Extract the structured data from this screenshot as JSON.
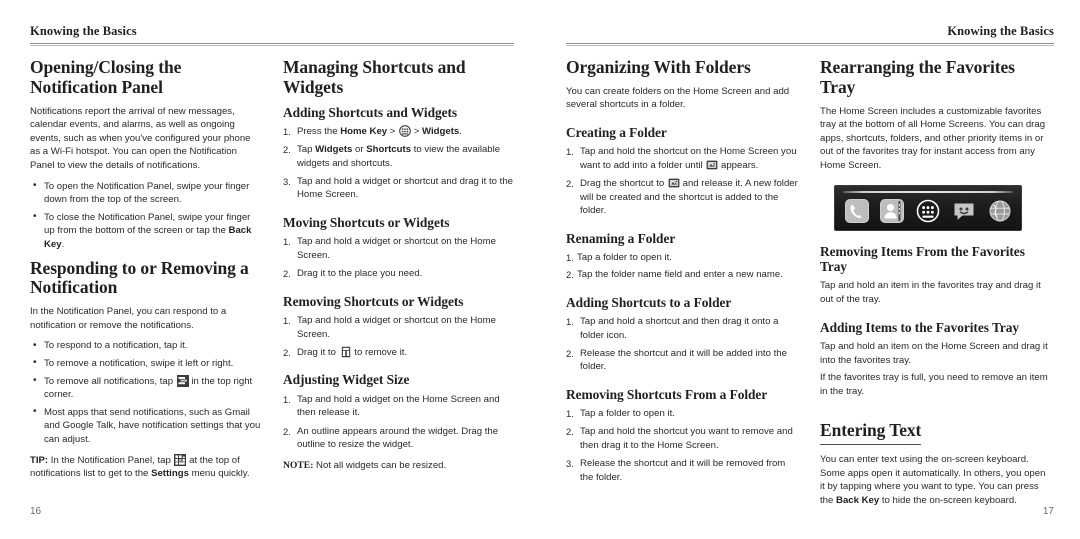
{
  "spread": {
    "left_page": {
      "running_head": "Knowing the Basics",
      "folio": "16",
      "columns": [
        {
          "sections": [
            {
              "heading": "Opening/Closing the Notification Panel",
              "paragraphs": [
                "Notifications report the arrival of new messages, calendar events, and alarms, as well as ongoing events, such as when you've configured your phone as a Wi-Fi hotspot. You can open the Notification Panel to view the details of notifications."
              ],
              "bullets": [
                "To open the Notification Panel, swipe your finger down from the top of the screen.",
                "To close the Notification Panel, swipe your finger up from the bottom of the screen or tap the Back Key."
              ]
            },
            {
              "heading": "Responding to or Removing a Notification",
              "paragraphs": [
                "In the Notification Panel, you can respond to a notification or remove the notifications."
              ],
              "bullets": [
                "To respond to a notification, tap it.",
                "To remove a notification, swipe it left or right.",
                "To remove all notifications, tap [clear-notifications-icon] in the top right corner.",
                "Most apps that send notifications, such as Gmail and Google Talk, have notification settings that you can adjust."
              ],
              "tip": "TIP: In the Notification Panel, tap [settings-icon] at the top of notifications list to get to the Settings menu quickly."
            }
          ]
        },
        {
          "sections": [
            {
              "heading": "Managing Shortcuts and Widgets",
              "subsections": [
                {
                  "heading": "Adding Shortcuts and Widgets",
                  "steps": [
                    "Press the Home Key > [app-drawer-icon] > Widgets.",
                    "Tap Widgets or Shortcuts to view the available widgets and shortcuts.",
                    "Tap and hold a widget or shortcut and drag it to the Home Screen."
                  ]
                },
                {
                  "heading": "Moving Shortcuts or Widgets",
                  "steps": [
                    "Tap and hold a widget or shortcut on the Home Screen.",
                    "Drag it to the place you need."
                  ]
                },
                {
                  "heading": "Removing Shortcuts or Widgets",
                  "steps": [
                    "Tap and hold a widget or shortcut on the Home Screen.",
                    "Drag it to [remove-trash-icon] to remove it."
                  ]
                },
                {
                  "heading": "Adjusting Widget Size",
                  "steps": [
                    "Tap and hold a widget on the Home Screen and then release it.",
                    "An outline appears around the widget. Drag the outline to resize the widget."
                  ],
                  "note": "NOTE: Not all widgets can be resized."
                }
              ]
            }
          ]
        }
      ]
    },
    "right_page": {
      "running_head": "Knowing the Basics",
      "folio": "17",
      "columns": [
        {
          "sections": [
            {
              "heading": "Organizing With Folders",
              "paragraphs": [
                "You can create folders on the Home Screen and add several shortcuts in a folder."
              ],
              "subsections": [
                {
                  "heading": "Creating a Folder",
                  "steps": [
                    "Tap and hold the shortcut on the Home Screen you want to add into a folder until [folder-icon] appears.",
                    "Drag the shortcut to [folder-icon] and release it. A new folder will be created and the shortcut is added to the folder."
                  ]
                },
                {
                  "heading": "Renaming a Folder",
                  "steps": [
                    "Tap a folder to open it.",
                    "Tap the folder name field and enter a new name."
                  ]
                },
                {
                  "heading": "Adding Shortcuts to a Folder",
                  "steps": [
                    "Tap and hold a shortcut and then drag it onto a folder icon.",
                    "Release the shortcut and it will be added into the folder."
                  ]
                },
                {
                  "heading": "Removing Shortcuts From a Folder",
                  "steps": [
                    "Tap a folder to open it.",
                    "Tap and hold the shortcut you want to remove and then drag it to the Home Screen.",
                    "Release the shortcut and it will be removed from the folder."
                  ]
                }
              ]
            }
          ]
        },
        {
          "sections": [
            {
              "heading": "Rearranging the Favorites Tray",
              "paragraphs": [
                "The Home Screen includes a customizable favorites tray at the bottom of all Home Screens. You can drag apps, shortcuts, folders, and other priority items in or out of the favorites tray for instant access from any Home Screen."
              ],
              "figure": {
                "name": "favorites-tray-figure",
                "icons": [
                  "phone-icon",
                  "contacts-icon",
                  "app-drawer-icon",
                  "messaging-icon",
                  "browser-globe-icon"
                ]
              },
              "subsections": [
                {
                  "heading": "Removing Items From the Favorites Tray",
                  "paragraphs": [
                    "Tap and hold an item in the favorites tray and drag it out of the tray."
                  ]
                },
                {
                  "heading": "Adding Items to the Favorites Tray",
                  "paragraphs": [
                    "Tap and hold an item on the Home Screen and drag it into the favorites tray.",
                    "If the favorites tray is full, you need to remove an item in the tray."
                  ]
                }
              ]
            },
            {
              "heading": "Entering Text",
              "underlined": true,
              "paragraphs": [
                "You can enter text using the on-screen keyboard. Some apps open it automatically. In others, you open it by tapping where you want to type. You can press the Back Key to hide the on-screen keyboard."
              ]
            }
          ]
        }
      ]
    }
  },
  "text": {
    "l_c1_s1_head": "Opening/Closing the Notification Panel",
    "l_c1_s1_p1": "Notifications report the arrival of new messages, calendar events, and alarms, as well as ongoing events, such as when you've configured your phone as a Wi-Fi hotspot. You can open the Notification Panel to view the details of notifications.",
    "l_c1_s1_b1": "To open the Notification Panel, swipe your finger down from the top of the screen.",
    "l_c1_s1_b2a": "To close the Notification Panel, swipe your finger up from the bottom of the screen or tap the ",
    "l_c1_s1_b2b": "Back Key",
    "l_c1_s1_b2c": ".",
    "l_c1_s2_head": "Responding to or Removing a Notification",
    "l_c1_s2_p1": "In the Notification Panel, you can respond to a notification or remove the notifications.",
    "l_c1_s2_b1": "To respond to a notification, tap it.",
    "l_c1_s2_b2": "To remove a notification, swipe it left or right.",
    "l_c1_s2_b3a": "To remove all notifications, tap",
    "l_c1_s2_b3b": "in the top right corner.",
    "l_c1_s2_b4": "Most apps that send notifications, such as Gmail and Google Talk, have notification settings that you can adjust.",
    "l_c1_tip_label": "TIP:",
    "l_c1_tip_a": " In the Notification Panel, tap",
    "l_c1_tip_b": "at the top of notifications list to get to the ",
    "l_c1_tip_bold": "Settings",
    "l_c1_tip_c": " menu quickly.",
    "l_c2_head": "Managing Shortcuts and Widgets",
    "l_c2_s1_head": "Adding Shortcuts and Widgets",
    "l_c2_s1_1a": "Press the ",
    "l_c2_s1_1b": "Home Key",
    "l_c2_s1_1c": " > ",
    "l_c2_s1_1d": " > ",
    "l_c2_s1_1e": "Widgets",
    "l_c2_s1_1f": ".",
    "l_c2_s1_2a": "Tap ",
    "l_c2_s1_2b": "Widgets",
    "l_c2_s1_2c": " or ",
    "l_c2_s1_2d": "Shortcuts",
    "l_c2_s1_2e": " to view the available widgets and shortcuts.",
    "l_c2_s1_3": "Tap and hold a widget or shortcut and drag it to the Home Screen.",
    "l_c2_s2_head": "Moving Shortcuts or Widgets",
    "l_c2_s2_1": "Tap and hold a widget or shortcut on the Home Screen.",
    "l_c2_s2_2": "Drag it to the place you need.",
    "l_c2_s3_head": "Removing Shortcuts or Widgets",
    "l_c2_s3_1": "Tap and hold a widget or shortcut on the Home Screen.",
    "l_c2_s3_2a": "Drag it to",
    "l_c2_s3_2b": "to remove it.",
    "l_c2_s4_head": "Adjusting Widget Size",
    "l_c2_s4_1": "Tap and hold a widget on the Home Screen and then release it.",
    "l_c2_s4_2": "An outline appears around the widget. Drag the outline to resize the widget.",
    "l_c2_note_label": "NOTE:",
    "l_c2_note_text": " Not all widgets can be resized.",
    "r_c1_head": "Organizing With Folders",
    "r_c1_p1": "You can create folders on the Home Screen and add several shortcuts in a folder.",
    "r_c1_s1_head": "Creating a Folder",
    "r_c1_s1_1a": "Tap and hold the shortcut on the Home Screen you want to add into a folder until",
    "r_c1_s1_1b": "appears.",
    "r_c1_s1_2a": "Drag the shortcut to",
    "r_c1_s1_2b": "and release it. A new folder will be created and the shortcut is added to the folder.",
    "r_c1_s2_head": "Renaming a Folder",
    "r_c1_s2_1": "Tap a folder to open it.",
    "r_c1_s2_2": "Tap the folder name field and enter a new name.",
    "r_c1_s3_head": "Adding Shortcuts to a Folder",
    "r_c1_s3_1": "Tap and hold a shortcut and then drag it onto a folder icon.",
    "r_c1_s3_2": "Release the shortcut and it will be added into the folder.",
    "r_c1_s4_head": "Removing Shortcuts From a Folder",
    "r_c1_s4_1": "Tap a folder to open it.",
    "r_c1_s4_2": "Tap and hold the shortcut you want to remove and then drag it to the Home Screen.",
    "r_c1_s4_3": "Release the shortcut and it will be removed from the folder.",
    "r_c2_head": "Rearranging the Favorites Tray",
    "r_c2_p1": "The Home Screen includes a customizable favorites tray at the bottom of all Home Screens. You can drag apps, shortcuts, folders, and other priority items in or out of the favorites tray for instant access from any Home Screen.",
    "r_c2_s1_head": "Removing Items From the Favorites Tray",
    "r_c2_s1_p1": "Tap and hold an item in the favorites tray and drag it out of the tray.",
    "r_c2_s2_head": "Adding Items to the Favorites Tray",
    "r_c2_s2_p1": "Tap and hold an item on the Home Screen and drag it into the favorites tray.",
    "r_c2_s2_p2": "If the favorites tray is full, you need to remove an item in the tray.",
    "r_c2_s3_head": "Entering Text",
    "r_c2_s3_p1a": "You can enter text using the on-screen keyboard. Some apps open it automatically. In others, you open it by tapping where you want to type. You can press the ",
    "r_c2_s3_p1b": "Back Key",
    "r_c2_s3_p1c": " to hide the on-screen keyboard."
  }
}
